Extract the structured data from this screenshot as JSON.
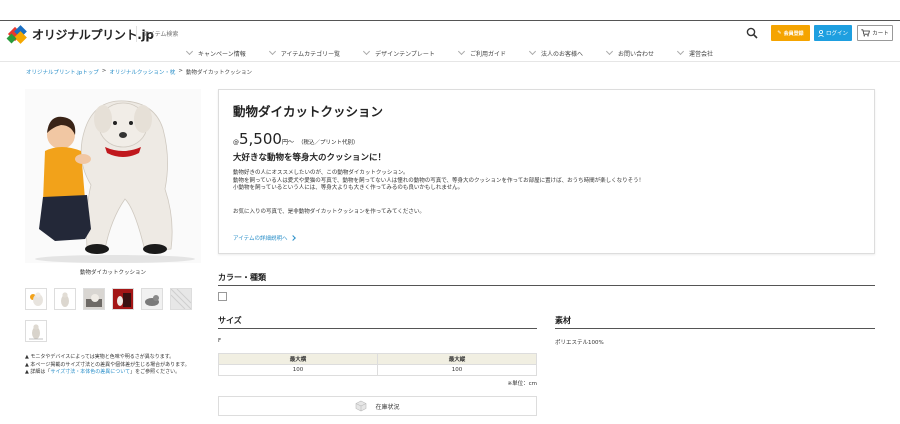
{
  "header": {
    "logo_text": "オリジナルプリント.jp",
    "search_placeholder": "アイテム検索",
    "register_label": "会員登録",
    "login_label": "ログイン",
    "cart_label": "カート"
  },
  "nav": {
    "items": [
      {
        "label": "キャンペーン情報"
      },
      {
        "label": "アイテムカテゴリー覧"
      },
      {
        "label": "デザインテンプレート"
      },
      {
        "label": "ご利用ガイド"
      },
      {
        "label": "法人のお客様へ"
      },
      {
        "label": "お問い合わせ"
      },
      {
        "label": "運営会社"
      }
    ]
  },
  "breadcrumb": {
    "home": "オリジナルプリント.jpトップ",
    "category": "オリジナルクッション・枕",
    "current": "動物ダイカットクッション"
  },
  "gallery": {
    "caption": "動物ダイカットクッション"
  },
  "notes": {
    "line1": "▲ モニタやデバイスによっては実物と色味や明るさが異なります。",
    "line2": "▲ 本ページ掲載のサイズ寸法との差異や個体差が生じる場合があります。",
    "line3_prefix": "▲ 詳細は「",
    "line3_link": "サイズ寸法・本体色の差異について",
    "line3_suffix": "」をご参照ください。"
  },
  "product": {
    "name": "動物ダイカットクッション",
    "price_at": "@",
    "price": "5,500",
    "price_suffix": "円〜",
    "price_tax": "（税込／プリント代別）",
    "tagline": "大好きな動物を等身大のクッションに！",
    "desc_line1": "動物好きの人にオススメしたいのが、この動物ダイカットクッション。",
    "desc_line2": "動物を飼っている人は愛犬や愛猫の写真で、動物を飼ってない人は憧れの動物の写真で、等身大のクッションを作ってお部屋に置けば、おうち時間が楽しくなりそう！",
    "desc_line3": "小動物を飼っているという人には、等身大よりも大きく作ってみるのも良いかもしれません。",
    "desc_line4": "お気に入りの写真で、是非動物ダイカットクッションを作ってみてください。",
    "detail_link": "アイテムの詳細説明へ"
  },
  "sections": {
    "color_title": "カラー・種類",
    "size_title": "サイズ",
    "material_title": "素材",
    "size_value": "F",
    "material_value": "ポリエステル100%"
  },
  "size_table": {
    "headers": [
      "最大横",
      "最大縦"
    ],
    "row": [
      "100",
      "100"
    ],
    "unit": "※単位：cm"
  },
  "stock": {
    "label": "在庫状況"
  }
}
